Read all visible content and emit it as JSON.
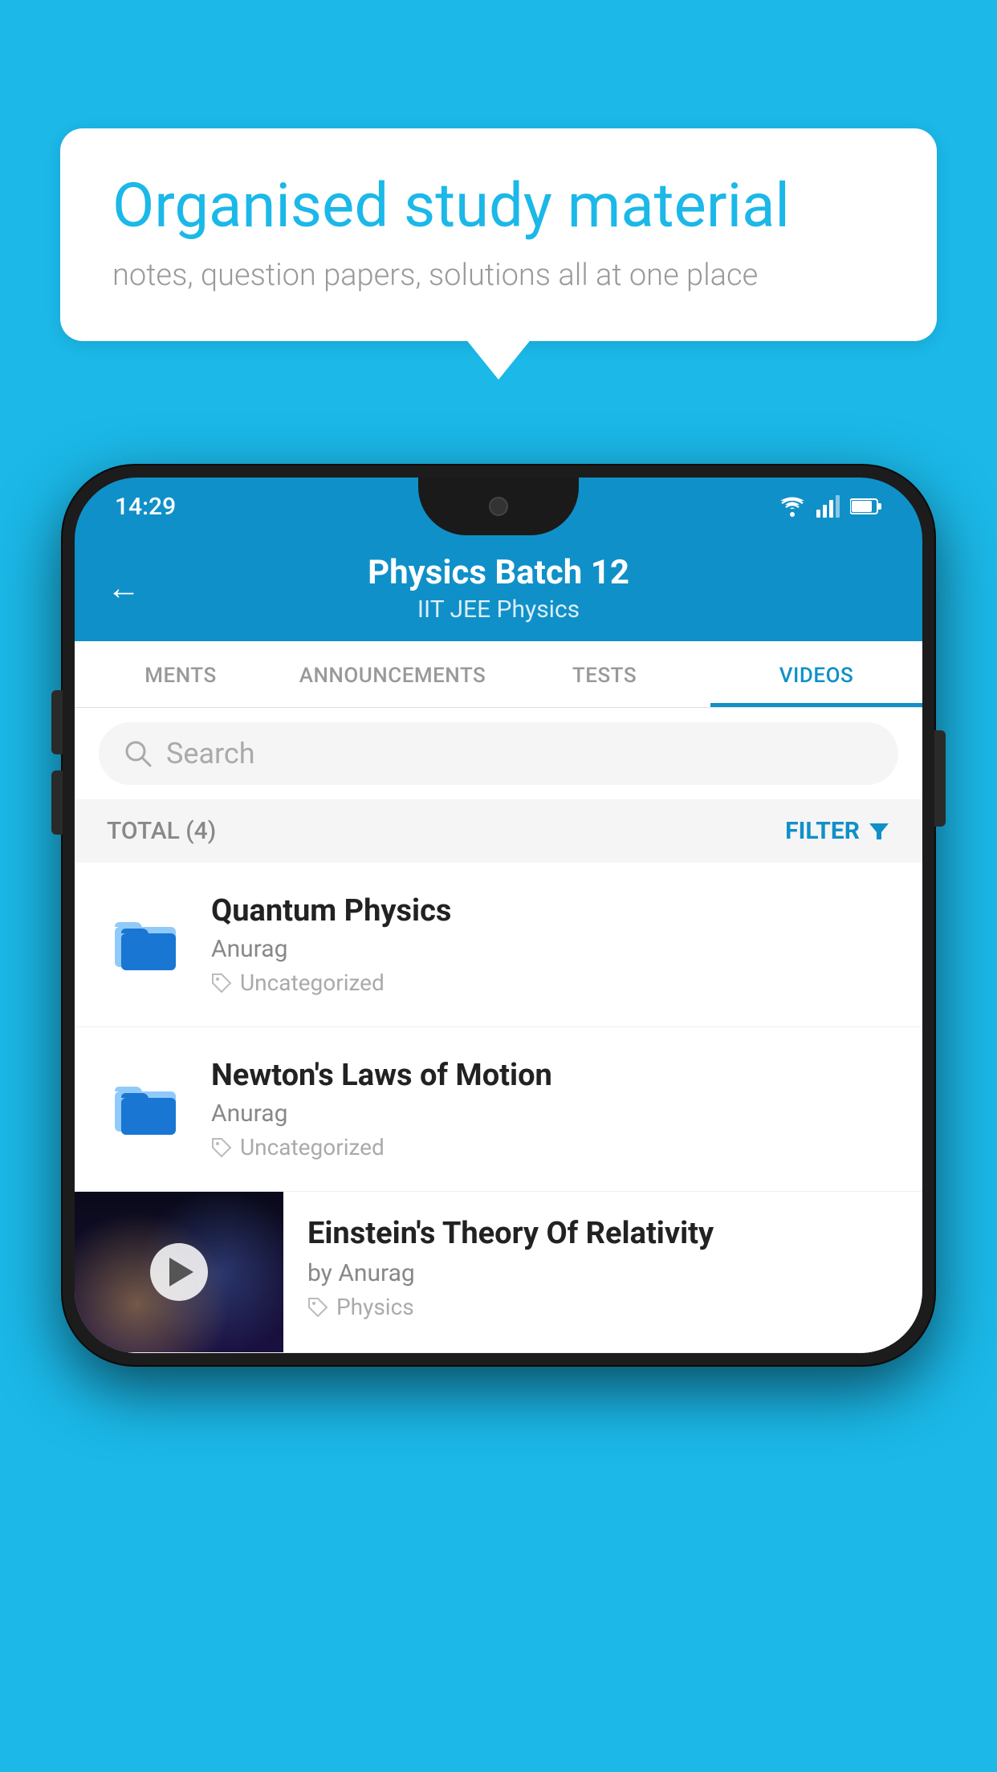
{
  "background_color": "#1BB8E8",
  "speech_bubble": {
    "title": "Organised study material",
    "subtitle": "notes, question papers, solutions all at one place"
  },
  "status_bar": {
    "time": "14:29",
    "wifi": "▼",
    "signal": "▲",
    "battery": "▌"
  },
  "app_header": {
    "title": "Physics Batch 12",
    "subtitle": "IIT JEE    Physics",
    "back_label": "←"
  },
  "tabs": [
    {
      "label": "MENTS",
      "active": false
    },
    {
      "label": "ANNOUNCEMENTS",
      "active": false
    },
    {
      "label": "TESTS",
      "active": false
    },
    {
      "label": "VIDEOS",
      "active": true
    }
  ],
  "search": {
    "placeholder": "Search"
  },
  "filter_bar": {
    "total_label": "TOTAL (4)",
    "filter_label": "FILTER"
  },
  "list_items": [
    {
      "title": "Quantum Physics",
      "author": "Anurag",
      "tag": "Uncategorized",
      "type": "folder"
    },
    {
      "title": "Newton's Laws of Motion",
      "author": "Anurag",
      "tag": "Uncategorized",
      "type": "folder"
    }
  ],
  "video_item": {
    "title": "Einstein's Theory Of Relativity",
    "author": "by Anurag",
    "tag": "Physics",
    "type": "video"
  },
  "icons": {
    "search": "🔍",
    "filter_funnel": "▼",
    "tag": "🏷",
    "back_arrow": "←",
    "play": "▶"
  }
}
